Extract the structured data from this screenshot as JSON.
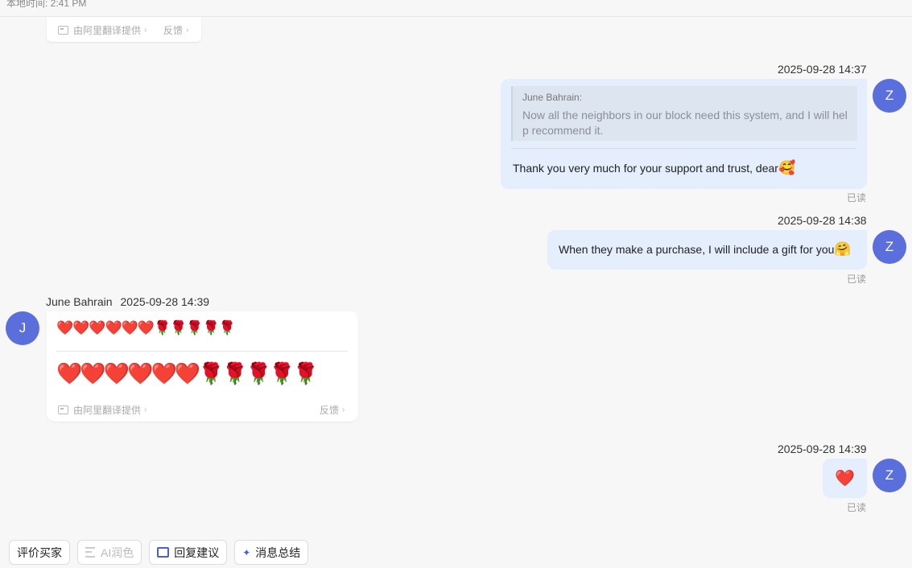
{
  "header": {
    "local_time": "本地时间: 2:41 PM"
  },
  "translation": {
    "provider": "由阿里翻译提供",
    "feedback": "反馈"
  },
  "messages": [
    {
      "timestamp": "2025-09-28 14:37",
      "avatar": "Z",
      "quote_name": "June Bahrain:",
      "quote_text": "Now all the neighbors in our block need this system, and I will help recommend it.",
      "text": "Thank you very much for your support and trust, dear",
      "emoji": "🥰",
      "status": "已读"
    },
    {
      "timestamp": "2025-09-28 14:38",
      "avatar": "Z",
      "text": "When they make a purchase, I will include a gift for you",
      "emoji": "🤗",
      "status": "已读"
    },
    {
      "sender": "June Bahrain",
      "timestamp": "2025-09-28 14:39",
      "avatar": "J",
      "original": "❤️❤️❤️❤️❤️❤️🌹🌹🌹🌹🌹",
      "translated": "❤️❤️❤️❤️❤️❤️🌹🌹🌹🌹🌹"
    },
    {
      "timestamp": "2025-09-28 14:39",
      "avatar": "Z",
      "emoji": "❤️",
      "status": "已读"
    }
  ],
  "toolbar": {
    "rate_buyer": "评价买家",
    "ai_polish": "AI润色",
    "reply_suggest": "回复建议",
    "msg_summary": "消息总结"
  },
  "colors": {
    "avatar_bg": "#5a6fdc",
    "bubble_out": "#e4eefc",
    "accent": "#4a5fd0"
  }
}
